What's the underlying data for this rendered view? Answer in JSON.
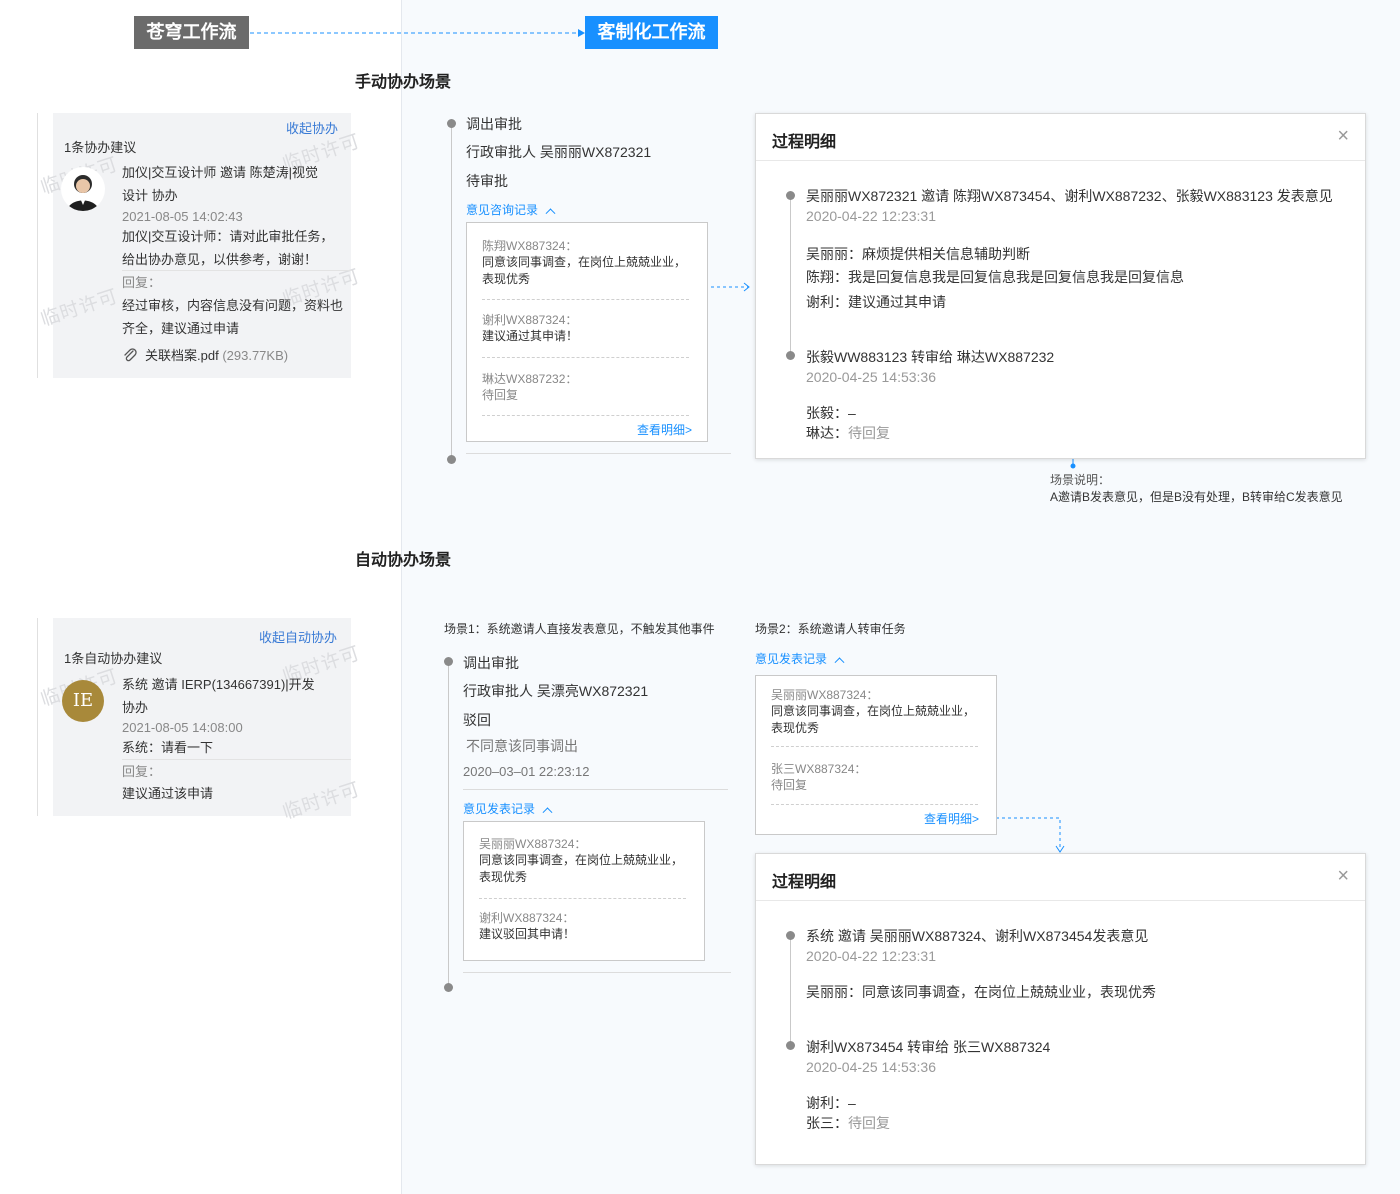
{
  "tags": {
    "source": "苍穹工作流",
    "target": "客制化工作流"
  },
  "colors": {
    "accent": "#1890ff",
    "tag_gray": "#6b6b6b",
    "avatar_gold": "#a8893a"
  },
  "manual": {
    "title": "手动协办场景",
    "card": {
      "collapse_link": "收起协办",
      "count": "1条协办建议",
      "line1": "加仪|交互设计师 邀请 陈楚涛|视觉",
      "line2": "设计 协办",
      "time": "2021-08-05 14:02:43",
      "msg1": "加仪|交互设计师：请对此审批任务，",
      "msg2": "给出协办意见，以供参考，谢谢！",
      "reply_label": "回复：",
      "reply1": "经过审核，内容信息没有问题，资料也",
      "reply2": "齐全，建议通过申请",
      "attachment_name": "关联档案.pdf",
      "attachment_size": "(293.77KB)",
      "watermark": "临时许可"
    },
    "timeline": {
      "step": "调出审批",
      "approver": "行政审批人 吴丽丽WX872321",
      "status": "待审批",
      "record_link": "意见咨询记录",
      "records": [
        {
          "name": "陈翔WX887324：",
          "msg1": "同意该同事调查，在岗位上兢兢业业，",
          "msg2": "表现优秀"
        },
        {
          "name": "谢利WX887324：",
          "msg1": "建议通过其申请！",
          "msg2": ""
        },
        {
          "name": "琳达WX887232：",
          "msg1": "待回复",
          "msg2": ""
        }
      ],
      "detail_link": "查看明细>"
    },
    "modal": {
      "title": "过程明细",
      "close": "×",
      "event1": "吴丽丽WX872321 邀请 陈翔WX873454、谢利WX887232、张毅WX883123 发表意见",
      "event1_time": "2020-04-22 12:23:31",
      "event1_lines": [
        {
          "who": "吴丽丽：",
          "text": "麻烦提供相关信息辅助判断"
        },
        {
          "who": "陈翔：",
          "text": "我是回复信息我是回复信息我是回复信息我是回复信息"
        },
        {
          "who": "谢利：",
          "text": "建议通过其申请"
        }
      ],
      "event2": "张毅WW883123 转审给 琳达WX887232",
      "event2_time": "2020-04-25 14:53:36",
      "event2_lines": [
        {
          "who": "张毅：",
          "text": "–"
        },
        {
          "who": "琳达：",
          "text": "待回复"
        }
      ]
    },
    "note_label": "场景说明：",
    "note_text": "A邀请B发表意见，但是B没有处理，B转审给C发表意见"
  },
  "auto": {
    "title": "自动协办场景",
    "card": {
      "collapse_link": "收起自动协办",
      "count": "1条自动协办建议",
      "avatar": "IE",
      "line1": "系统 邀请 IERP(134667391)|开发",
      "line2": "协办",
      "time": "2021-08-05 14:08:00",
      "msg": "系统：请看一下",
      "reply_label": "回复：",
      "reply": "建议通过该申请",
      "watermark": "临时许可"
    },
    "scene1": {
      "label": "场景1：系统邀请人直接发表意见，不触发其他事件",
      "step": "调出审批",
      "approver": "行政审批人 吴漂亮WX872321",
      "status": "驳回",
      "comment": "不同意该同事调出",
      "time": "2020–03–01 22:23:12",
      "record_link": "意见发表记录",
      "records": [
        {
          "name": "吴丽丽WX887324：",
          "msg1": "同意该同事调查，在岗位上兢兢业业，",
          "msg2": "表现优秀"
        },
        {
          "name": "谢利WX887324：",
          "msg1": "建议驳回其申请！",
          "msg2": ""
        }
      ]
    },
    "scene2": {
      "label": "场景2：系统邀请人转审任务",
      "record_link": "意见发表记录",
      "records": [
        {
          "name": "吴丽丽WX887324：",
          "msg1": "同意该同事调查，在岗位上兢兢业业，",
          "msg2": "表现优秀"
        },
        {
          "name": "张三WX887324：",
          "msg1": "待回复",
          "msg2": ""
        }
      ],
      "detail_link": "查看明细>"
    },
    "modal": {
      "title": "过程明细",
      "close": "×",
      "event1": "系统 邀请 吴丽丽WX887324、谢利WX873454发表意见",
      "event1_time": "2020-04-22 12:23:31",
      "event1_lines": [
        {
          "who": "吴丽丽：",
          "text": "同意该同事调查，在岗位上兢兢业业，表现优秀"
        }
      ],
      "event2": "谢利WX873454 转审给 张三WX887324",
      "event2_time": "2020-04-25 14:53:36",
      "event2_lines": [
        {
          "who": "谢利：",
          "text": "–"
        },
        {
          "who": "张三：",
          "text": "待回复"
        }
      ]
    }
  }
}
